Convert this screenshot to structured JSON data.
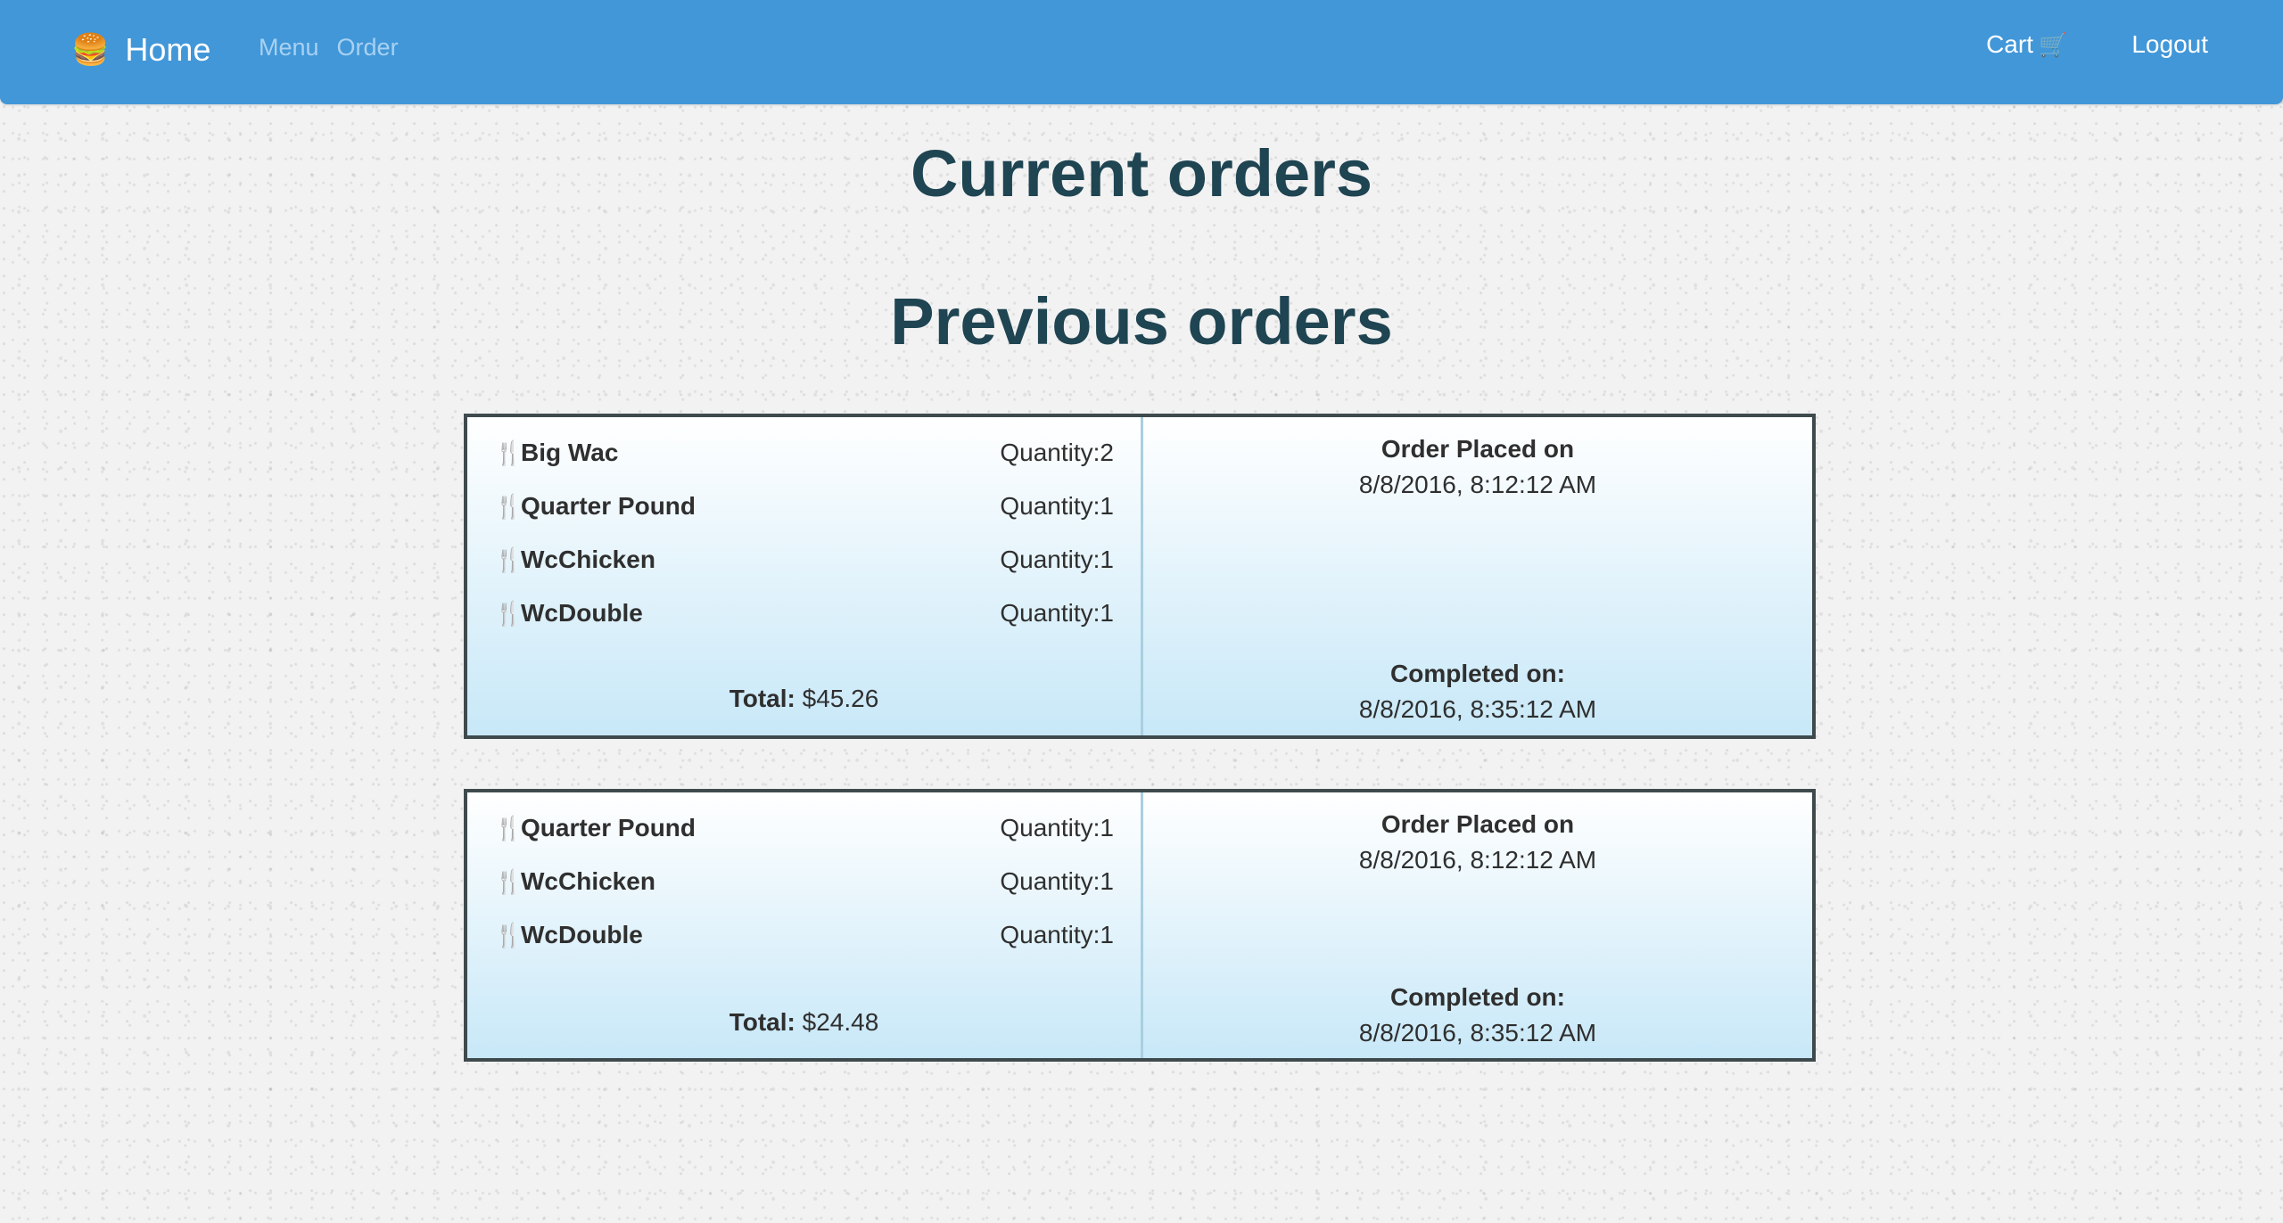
{
  "navbar": {
    "brand_icon": "burger-emoji",
    "brand_label": "Home",
    "links": [
      "Menu",
      "Order"
    ],
    "cart_label": "Cart",
    "cart_icon": "shopping-cart-icon",
    "logout_label": "Logout",
    "color": "#4197d8"
  },
  "page": {
    "current_title": "Current orders",
    "previous_title": "Previous orders"
  },
  "orders": [
    {
      "items": [
        {
          "name": "Big Wac",
          "qty_label": "Quantity:",
          "qty": "2"
        },
        {
          "name": "Quarter Pound",
          "qty_label": "Quantity:",
          "qty": "1"
        },
        {
          "name": "WcChicken",
          "qty_label": "Quantity:",
          "qty": "1"
        },
        {
          "name": "WcDouble",
          "qty_label": "Quantity:",
          "qty": "1"
        }
      ],
      "total_label": "Total:",
      "total_value": "$45.26",
      "placed_label": "Order Placed on",
      "placed_value": "8/8/2016, 8:12:12 AM",
      "completed_label": "Completed on:",
      "completed_value": "8/8/2016, 8:35:12 AM"
    },
    {
      "items": [
        {
          "name": "Quarter Pound",
          "qty_label": "Quantity:",
          "qty": "1"
        },
        {
          "name": "WcChicken",
          "qty_label": "Quantity:",
          "qty": "1"
        },
        {
          "name": "WcDouble",
          "qty_label": "Quantity:",
          "qty": "1"
        }
      ],
      "total_label": "Total:",
      "total_value": "$24.48",
      "placed_label": "Order Placed on",
      "placed_value": "8/8/2016, 8:12:12 AM",
      "completed_label": "Completed on:",
      "completed_value": "8/8/2016, 8:35:12 AM"
    }
  ]
}
